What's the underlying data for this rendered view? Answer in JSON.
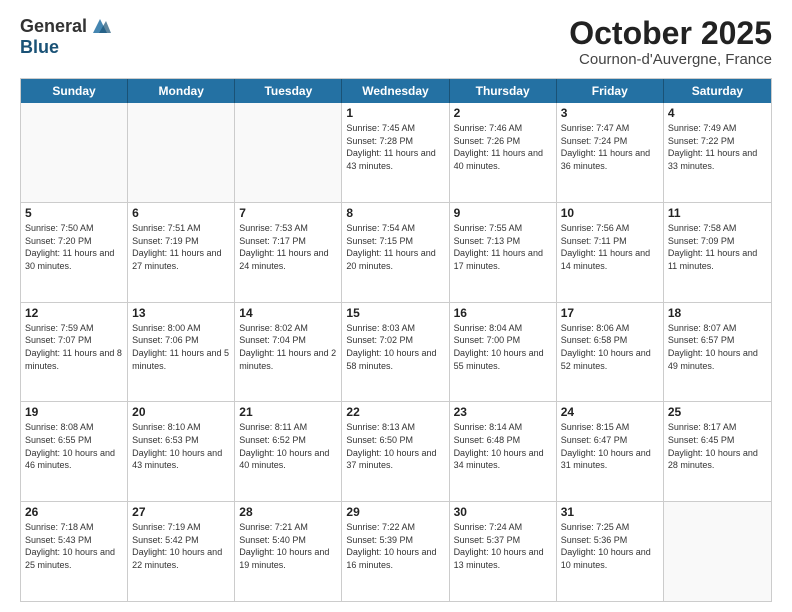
{
  "header": {
    "logo_line1": "General",
    "logo_line2": "Blue",
    "month": "October 2025",
    "location": "Cournon-d'Auvergne, France"
  },
  "days_of_week": [
    "Sunday",
    "Monday",
    "Tuesday",
    "Wednesday",
    "Thursday",
    "Friday",
    "Saturday"
  ],
  "weeks": [
    [
      {
        "day": "",
        "empty": true,
        "info": ""
      },
      {
        "day": "",
        "empty": true,
        "info": ""
      },
      {
        "day": "",
        "empty": true,
        "info": ""
      },
      {
        "day": "1",
        "info": "Sunrise: 7:45 AM\nSunset: 7:28 PM\nDaylight: 11 hours and 43 minutes."
      },
      {
        "day": "2",
        "info": "Sunrise: 7:46 AM\nSunset: 7:26 PM\nDaylight: 11 hours and 40 minutes."
      },
      {
        "day": "3",
        "info": "Sunrise: 7:47 AM\nSunset: 7:24 PM\nDaylight: 11 hours and 36 minutes."
      },
      {
        "day": "4",
        "info": "Sunrise: 7:49 AM\nSunset: 7:22 PM\nDaylight: 11 hours and 33 minutes."
      }
    ],
    [
      {
        "day": "5",
        "info": "Sunrise: 7:50 AM\nSunset: 7:20 PM\nDaylight: 11 hours and 30 minutes."
      },
      {
        "day": "6",
        "info": "Sunrise: 7:51 AM\nSunset: 7:19 PM\nDaylight: 11 hours and 27 minutes."
      },
      {
        "day": "7",
        "info": "Sunrise: 7:53 AM\nSunset: 7:17 PM\nDaylight: 11 hours and 24 minutes."
      },
      {
        "day": "8",
        "info": "Sunrise: 7:54 AM\nSunset: 7:15 PM\nDaylight: 11 hours and 20 minutes."
      },
      {
        "day": "9",
        "info": "Sunrise: 7:55 AM\nSunset: 7:13 PM\nDaylight: 11 hours and 17 minutes."
      },
      {
        "day": "10",
        "info": "Sunrise: 7:56 AM\nSunset: 7:11 PM\nDaylight: 11 hours and 14 minutes."
      },
      {
        "day": "11",
        "info": "Sunrise: 7:58 AM\nSunset: 7:09 PM\nDaylight: 11 hours and 11 minutes."
      }
    ],
    [
      {
        "day": "12",
        "info": "Sunrise: 7:59 AM\nSunset: 7:07 PM\nDaylight: 11 hours and 8 minutes."
      },
      {
        "day": "13",
        "info": "Sunrise: 8:00 AM\nSunset: 7:06 PM\nDaylight: 11 hours and 5 minutes."
      },
      {
        "day": "14",
        "info": "Sunrise: 8:02 AM\nSunset: 7:04 PM\nDaylight: 11 hours and 2 minutes."
      },
      {
        "day": "15",
        "info": "Sunrise: 8:03 AM\nSunset: 7:02 PM\nDaylight: 10 hours and 58 minutes."
      },
      {
        "day": "16",
        "info": "Sunrise: 8:04 AM\nSunset: 7:00 PM\nDaylight: 10 hours and 55 minutes."
      },
      {
        "day": "17",
        "info": "Sunrise: 8:06 AM\nSunset: 6:58 PM\nDaylight: 10 hours and 52 minutes."
      },
      {
        "day": "18",
        "info": "Sunrise: 8:07 AM\nSunset: 6:57 PM\nDaylight: 10 hours and 49 minutes."
      }
    ],
    [
      {
        "day": "19",
        "info": "Sunrise: 8:08 AM\nSunset: 6:55 PM\nDaylight: 10 hours and 46 minutes."
      },
      {
        "day": "20",
        "info": "Sunrise: 8:10 AM\nSunset: 6:53 PM\nDaylight: 10 hours and 43 minutes."
      },
      {
        "day": "21",
        "info": "Sunrise: 8:11 AM\nSunset: 6:52 PM\nDaylight: 10 hours and 40 minutes."
      },
      {
        "day": "22",
        "info": "Sunrise: 8:13 AM\nSunset: 6:50 PM\nDaylight: 10 hours and 37 minutes."
      },
      {
        "day": "23",
        "info": "Sunrise: 8:14 AM\nSunset: 6:48 PM\nDaylight: 10 hours and 34 minutes."
      },
      {
        "day": "24",
        "info": "Sunrise: 8:15 AM\nSunset: 6:47 PM\nDaylight: 10 hours and 31 minutes."
      },
      {
        "day": "25",
        "info": "Sunrise: 8:17 AM\nSunset: 6:45 PM\nDaylight: 10 hours and 28 minutes."
      }
    ],
    [
      {
        "day": "26",
        "info": "Sunrise: 7:18 AM\nSunset: 5:43 PM\nDaylight: 10 hours and 25 minutes."
      },
      {
        "day": "27",
        "info": "Sunrise: 7:19 AM\nSunset: 5:42 PM\nDaylight: 10 hours and 22 minutes."
      },
      {
        "day": "28",
        "info": "Sunrise: 7:21 AM\nSunset: 5:40 PM\nDaylight: 10 hours and 19 minutes."
      },
      {
        "day": "29",
        "info": "Sunrise: 7:22 AM\nSunset: 5:39 PM\nDaylight: 10 hours and 16 minutes."
      },
      {
        "day": "30",
        "info": "Sunrise: 7:24 AM\nSunset: 5:37 PM\nDaylight: 10 hours and 13 minutes."
      },
      {
        "day": "31",
        "info": "Sunrise: 7:25 AM\nSunset: 5:36 PM\nDaylight: 10 hours and 10 minutes."
      },
      {
        "day": "",
        "empty": true,
        "info": ""
      }
    ]
  ]
}
